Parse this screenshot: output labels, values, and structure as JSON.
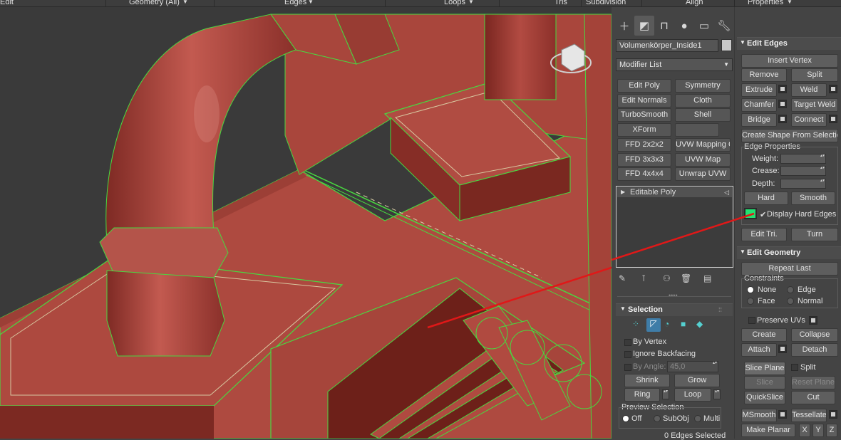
{
  "menubar": {
    "edit": "Edit",
    "geometry": "Geometry (All)",
    "edges": "Edges",
    "loops": "Loops",
    "tris": "Tris",
    "subdivision": "Subdivision",
    "align": "Align",
    "properties": "Properties"
  },
  "command_tabs": [
    {
      "icon": "plus-icon"
    },
    {
      "icon": "modify-icon"
    },
    {
      "icon": "hierarchy-icon"
    },
    {
      "icon": "motion-icon"
    },
    {
      "icon": "display-icon"
    },
    {
      "icon": "utilities-icon"
    }
  ],
  "object_name": "Volumenkörper_Inside1",
  "object_color": "#c8c8c8",
  "modifier_list": "Modifier List",
  "modifier_buttons": [
    "Edit Poly",
    "Symmetry",
    "Edit Normals",
    "Cloth",
    "TurboSmooth",
    "Shell",
    "XForm",
    "",
    "FFD 2x2x2",
    "UVW Mapping Clea",
    "FFD 3x3x3",
    "UVW Map",
    "FFD 4x4x4",
    "Unwrap UVW"
  ],
  "stack": {
    "item": "Editable Poly"
  },
  "selection": {
    "title": "Selection",
    "by_vertex": "By Vertex",
    "ignore_backfacing": "Ignore Backfacing",
    "by_angle": "By Angle:",
    "angle_value": "45,0",
    "shrink": "Shrink",
    "grow": "Grow",
    "ring": "Ring",
    "loop": "Loop",
    "preview": "Preview Selection",
    "off": "Off",
    "subobj": "SubObj",
    "multi": "Multi",
    "status": "0 Edges Selected"
  },
  "edit_edges": {
    "title": "Edit Edges",
    "insert_vertex": "Insert Vertex",
    "remove": "Remove",
    "split": "Split",
    "extrude": "Extrude",
    "weld": "Weld",
    "chamfer": "Chamfer",
    "target_weld": "Target Weld",
    "bridge": "Bridge",
    "connect": "Connect",
    "create_shape": "Create Shape From Selection",
    "edge_properties": "Edge Properties",
    "weight": "Weight:",
    "crease": "Crease:",
    "depth": "Depth:",
    "hard": "Hard",
    "smooth": "Smooth",
    "display_hard_edges": "Display Hard Edges",
    "hard_edge_color": "#22e070",
    "edit_tri": "Edit Tri.",
    "turn": "Turn"
  },
  "edit_geometry": {
    "title": "Edit Geometry",
    "repeat_last": "Repeat Last",
    "constraints": "Constraints",
    "none": "None",
    "edge": "Edge",
    "face": "Face",
    "normal": "Normal",
    "preserve_uvs": "Preserve UVs",
    "create": "Create",
    "collapse": "Collapse",
    "attach": "Attach",
    "detach": "Detach",
    "slice_plane": "Slice Plane",
    "split": "Split",
    "slice": "Slice",
    "reset_plane": "Reset Plane",
    "quickslice": "QuickSlice",
    "cut": "Cut",
    "msmooth": "MSmooth",
    "tessellate": "Tessellate",
    "make_planar": "Make Planar",
    "x": "X",
    "y": "Y",
    "z": "Z"
  },
  "colors": {
    "mesh": "#b2493f",
    "wire": "#4fe04a",
    "annotation_arrow": "#e01818"
  }
}
